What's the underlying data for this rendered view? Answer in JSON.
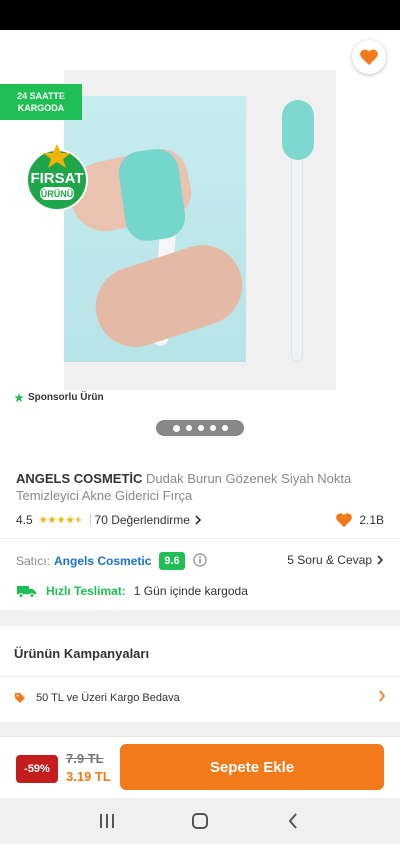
{
  "badges": {
    "kargo_line1": "24 SAATTE",
    "kargo_line2": "KARGODA",
    "firsat_line1": "FIRSAT",
    "firsat_line2": "ÜRÜNÜ"
  },
  "sponsored_label": "Sponsorlu Ürün",
  "gallery": {
    "image_count": 5,
    "active_index": 0
  },
  "product": {
    "brand": "ANGELS COSMETİC",
    "name": "Dudak Burun Gözenek Siyah Nokta Temizleyici Akne Giderici Fırça",
    "rating": "4.5",
    "rating_value": 4.5,
    "rating_max": 5,
    "reviews": "70 Değerlendirme",
    "likes": "2.1B"
  },
  "seller": {
    "label": "Satıcı:",
    "name": "Angels Cosmetic",
    "score": "9.6",
    "qa": "5 Soru & Cevap"
  },
  "delivery": {
    "label": "Hızlı Teslimat:",
    "value": "1 Gün içinde kargoda"
  },
  "campaigns": {
    "title": "Ürünün Kampanyaları",
    "item": "50 TL ve Üzeri Kargo Bedava"
  },
  "purchase": {
    "discount": "-59%",
    "old_price": "7.9 TL",
    "new_price": "3.19 TL",
    "add_to_cart": "Sepete Ekle"
  },
  "colors": {
    "accent": "#f27a1a",
    "green": "#1fbf56",
    "discount_red": "#c41d1d",
    "seller_blue": "#1a73c8"
  },
  "icons": [
    "back-arrow-icon",
    "share-icon",
    "heart-icon",
    "star-icon",
    "chevron-right-icon",
    "info-icon",
    "truck-icon",
    "tag-icon",
    "recents-icon",
    "home-icon",
    "nav-back-icon"
  ]
}
